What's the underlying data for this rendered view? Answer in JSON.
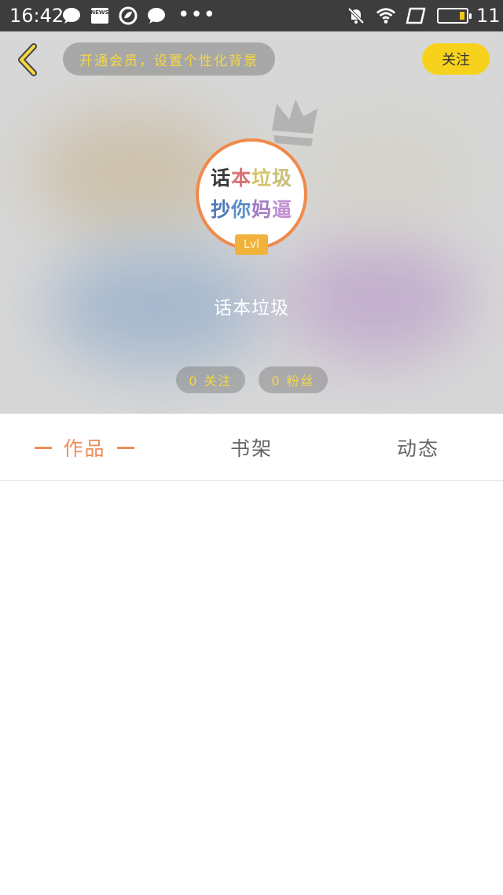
{
  "status_bar": {
    "time": "16:42",
    "news_label": "NEWS",
    "dots": "•••",
    "battery_level": "11",
    "battery_color": "#f5c518",
    "icons": [
      "chat-bubble-icon",
      "news-icon",
      "leaf-icon",
      "chat-bubble-icon",
      "more-dots-icon",
      "mute-icon",
      "wifi-icon",
      "screen-rotate-icon",
      "battery-icon"
    ]
  },
  "header": {
    "back_icon": "chevron-left-icon",
    "vip_text": "开通会员，设置个性化背景",
    "follow_label": "关注",
    "accent_yellow": "#f7d21c"
  },
  "profile": {
    "avatar_lines": [
      "话本垃圾",
      "抄你妈逼"
    ],
    "level": "Lvl",
    "username": "话本垃圾",
    "crown_icon": "crown-icon",
    "border_color": "#f08a4b"
  },
  "stats": {
    "follow": "0 关注",
    "fans": "0 粉丝"
  },
  "tabs": [
    {
      "label": "作品",
      "active": true
    },
    {
      "label": "书架",
      "active": false
    },
    {
      "label": "动态",
      "active": false
    }
  ],
  "accent_orange": "#ef8c56"
}
